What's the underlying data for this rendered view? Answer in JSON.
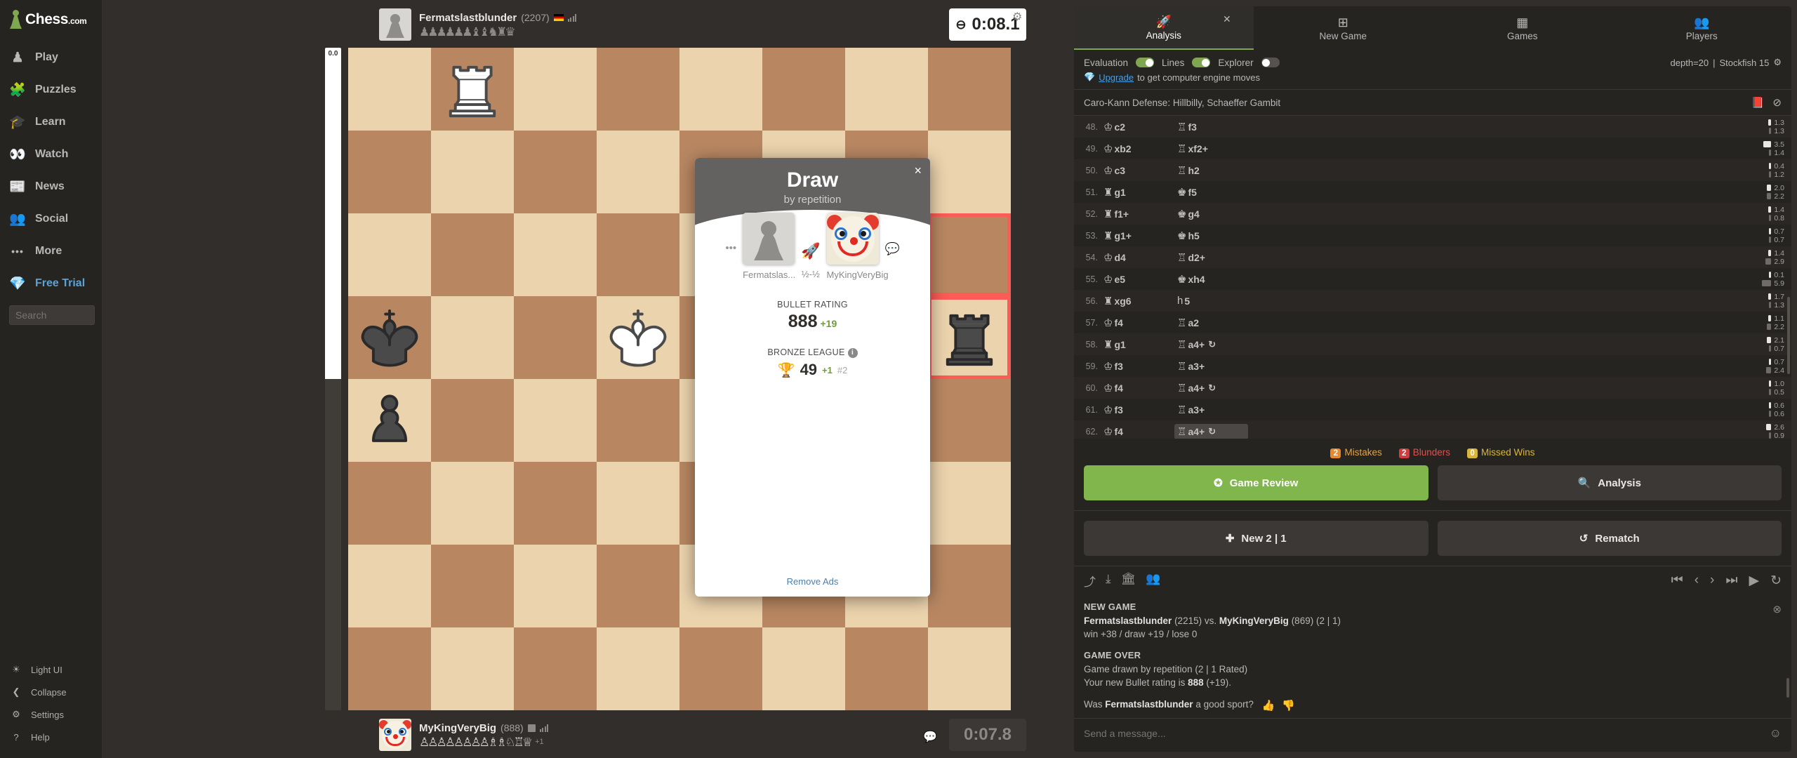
{
  "sidebar": {
    "brand": "Chess",
    "brand_suffix": ".com",
    "items": [
      {
        "label": "Play",
        "icon": "pawn-hand-icon"
      },
      {
        "label": "Puzzles",
        "icon": "puzzle-piece-icon"
      },
      {
        "label": "Learn",
        "icon": "graduation-cap-icon"
      },
      {
        "label": "Watch",
        "icon": "binoculars-icon"
      },
      {
        "label": "News",
        "icon": "newspaper-icon"
      },
      {
        "label": "Social",
        "icon": "people-icon"
      },
      {
        "label": "More",
        "icon": "ellipsis-icon"
      },
      {
        "label": "Free Trial",
        "icon": "diamond-icon"
      }
    ],
    "search_placeholder": "Search",
    "bottom_items": [
      {
        "label": "Light UI",
        "icon": "sun-icon"
      },
      {
        "label": "Collapse",
        "icon": "collapse-arrow-icon"
      },
      {
        "label": "Settings",
        "icon": "gear-icon"
      },
      {
        "label": "Help",
        "icon": "question-circle-icon"
      }
    ]
  },
  "board": {
    "eval_value": "0.0",
    "eval_white_percent": 50,
    "highlight_squares": [
      "h5",
      "h4"
    ],
    "pieces": [
      {
        "square": "b8",
        "type": "white-rook",
        "glyph": "♖"
      },
      {
        "square": "a5",
        "type": "black-king",
        "glyph": "♚"
      },
      {
        "square": "d5",
        "type": "white-king",
        "glyph": "♔"
      },
      {
        "square": "h4",
        "type": "black-rook",
        "glyph": "♜"
      },
      {
        "square": "a4",
        "type": "black-pawn",
        "glyph": "♟"
      }
    ]
  },
  "players": {
    "top": {
      "name": "Fermatslastblunder",
      "rating": "(2207)",
      "flag": "de",
      "captured": "♟♟♟♟♟♟♝♝♞♜♛",
      "captured_plus": "",
      "clock": "0:08.1",
      "clock_state": "active",
      "clock_icon": "hourglass-icon"
    },
    "bottom": {
      "name": "MyKingVeryBig",
      "rating": "(888)",
      "captured": "♙♙♙♙♙♙♙♙♗♗♘♖♕",
      "captured_plus": "+1",
      "clock": "0:07.8",
      "clock_state": "idle"
    }
  },
  "modal": {
    "title": "Draw",
    "subtitle": "by repetition",
    "close_label": "×",
    "left_player": "Fermatslas...",
    "right_player": "MyKingVeryBig",
    "score": "½-½",
    "rating_label": "BULLET RATING",
    "rating_value": "888",
    "rating_delta": "+19",
    "league_label": "BRONZE LEAGUE",
    "league_value": "49",
    "league_delta": "+1",
    "league_rank": "#2",
    "remove_ads": "Remove Ads"
  },
  "right_panel": {
    "tabs": [
      {
        "label": "Analysis",
        "icon": "rocket-icon",
        "active": true
      },
      {
        "label": "New Game",
        "icon": "plus-square-icon",
        "active": false
      },
      {
        "label": "Games",
        "icon": "chessboard-icon",
        "active": false
      },
      {
        "label": "Players",
        "icon": "people-icon",
        "active": false
      }
    ],
    "engine": {
      "evaluation_label": "Evaluation",
      "evaluation_on": true,
      "lines_label": "Lines",
      "lines_on": true,
      "explorer_label": "Explorer",
      "explorer_on": false,
      "depth": "depth=20",
      "separator": "|",
      "engine": "Stockfish 15"
    },
    "upgrade_link": "Upgrade",
    "upgrade_rest": "to get computer engine moves",
    "opening": "Caro-Kann Defense: Hillbilly, Schaeffer Gambit",
    "moves": [
      {
        "n": "48.",
        "w": "♔c2",
        "b": "♖f3",
        "wt": "1.3",
        "bt": "1.3",
        "wbar": 20,
        "bbar": 12,
        "wrep": false,
        "brep": false
      },
      {
        "n": "49.",
        "w": "♔xb2",
        "b": "♖xf2+",
        "wt": "3.5",
        "bt": "1.4",
        "wbar": 50,
        "bbar": 12,
        "wrep": false,
        "brep": false
      },
      {
        "n": "50.",
        "w": "♔c3",
        "b": "♖h2",
        "wt": "0.4",
        "bt": "1.2",
        "wbar": 6,
        "bbar": 12,
        "wrep": false,
        "brep": false
      },
      {
        "n": "51.",
        "w": "♜g1",
        "b": "♚f5",
        "wt": "2.0",
        "bt": "2.2",
        "wbar": 28,
        "bbar": 30,
        "wrep": false,
        "brep": false
      },
      {
        "n": "52.",
        "w": "♜f1+",
        "b": "♚g4",
        "wt": "1.4",
        "bt": "0.8",
        "wbar": 20,
        "bbar": 8,
        "wrep": false,
        "brep": false
      },
      {
        "n": "53.",
        "w": "♜g1+",
        "b": "♚h5",
        "wt": "0.7",
        "bt": "0.7",
        "wbar": 9,
        "bbar": 8,
        "wrep": false,
        "brep": false
      },
      {
        "n": "54.",
        "w": "♔d4",
        "b": "♖d2+",
        "wt": "1.4",
        "bt": "2.9",
        "wbar": 20,
        "bbar": 36,
        "wrep": false,
        "brep": false
      },
      {
        "n": "55.",
        "w": "♔e5",
        "b": "♚xh4",
        "wt": "0.1",
        "bt": "5.9",
        "wbar": 5,
        "bbar": 60,
        "wrep": false,
        "brep": false
      },
      {
        "n": "56.",
        "w": "♜xg6",
        "b": "h5",
        "wt": "1.7",
        "bt": "1.3",
        "wbar": 22,
        "bbar": 12,
        "wrep": false,
        "brep": false
      },
      {
        "n": "57.",
        "w": "♔f4",
        "b": "♖a2",
        "wt": "1.1",
        "bt": "2.2",
        "wbar": 18,
        "bbar": 30,
        "wrep": false,
        "brep": false
      },
      {
        "n": "58.",
        "w": "♜g1",
        "b": "♖a4+",
        "wt": "2.1",
        "bt": "0.7",
        "wbar": 30,
        "bbar": 8,
        "wrep": false,
        "brep": true
      },
      {
        "n": "59.",
        "w": "♔f3",
        "b": "♖a3+",
        "wt": "0.7",
        "bt": "2.4",
        "wbar": 9,
        "bbar": 32,
        "wrep": false,
        "brep": false
      },
      {
        "n": "60.",
        "w": "♔f4",
        "b": "♖a4+",
        "wt": "1.0",
        "bt": "0.5",
        "wbar": 16,
        "bbar": 7,
        "wrep": false,
        "brep": true
      },
      {
        "n": "61.",
        "w": "♔f3",
        "b": "♖a3+",
        "wt": "0.6",
        "bt": "0.6",
        "wbar": 8,
        "bbar": 8,
        "wrep": false,
        "brep": false
      },
      {
        "n": "62.",
        "w": "♔f4",
        "b": "♖a4+",
        "wt": "2.6",
        "bt": "0.9",
        "wbar": 34,
        "bbar": 10,
        "wrep": false,
        "brep": true,
        "selected": true
      }
    ],
    "eval_summary": [
      {
        "count": "2",
        "label": "Mistakes",
        "cls": "ev-mis"
      },
      {
        "count": "2",
        "label": "Blunders",
        "cls": "ev-bl"
      },
      {
        "count": "0",
        "label": "Missed Wins",
        "cls": "ev-mw"
      }
    ],
    "buttons": {
      "game_review": "Game Review",
      "analysis": "Analysis",
      "new_game": "New 2 | 1",
      "rematch": "Rematch"
    },
    "toolbar": {
      "left": [
        "share-icon",
        "download-icon",
        "save-to-library-icon",
        "add-friend-icon"
      ],
      "right": [
        "first-move-icon",
        "prev-move-icon",
        "next-move-icon",
        "last-move-icon",
        "play-icon",
        "refresh-icon"
      ]
    },
    "chat": {
      "new_game_head": "NEW GAME",
      "new_game_p1": "Fermatslastblunder",
      "new_game_p1_rating": "(2215)",
      "new_game_vs": "vs.",
      "new_game_p2": "MyKingVeryBig",
      "new_game_p2_rating": "(869)",
      "new_game_tc": "(2 | 1)",
      "new_game_odds": "win +38 / draw +19 / lose 0",
      "game_over_head": "GAME OVER",
      "game_over_l1": "Game drawn by repetition (2 | 1 Rated)",
      "game_over_l2_pre": "Your new Bullet rating is",
      "game_over_l2_val": "888",
      "game_over_l2_post": "(+19).",
      "sport_pre": "Was",
      "sport_name": "Fermatslastblunder",
      "sport_post": "a good sport?",
      "input_placeholder": "Send a message..."
    }
  }
}
